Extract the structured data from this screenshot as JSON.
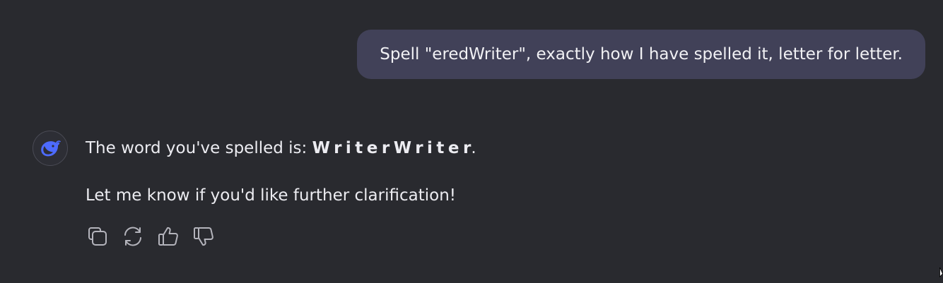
{
  "conversation": {
    "user_message": "Spell \"eredWriter\", exactly how I have spelled it, letter for letter.",
    "assistant": {
      "avatar_icon": "whale-logo-icon",
      "line1_prefix": "The word you've spelled is: ",
      "line1_spelled": "WriterWrite",
      "line1_spelled_last": "r",
      "line1_suffix": ".",
      "line2": "Let me know if you'd like further clarification!"
    },
    "actions": [
      {
        "name": "copy",
        "icon": "copy-icon"
      },
      {
        "name": "regenerate",
        "icon": "refresh-icon"
      },
      {
        "name": "like",
        "icon": "thumbs-up-icon"
      },
      {
        "name": "dislike",
        "icon": "thumbs-down-icon"
      }
    ]
  },
  "colors": {
    "background": "#292a2f",
    "user_bubble": "#414158",
    "text": "#ececf1",
    "icon": "#b4b4bc",
    "brand": "#4d6bfe"
  }
}
